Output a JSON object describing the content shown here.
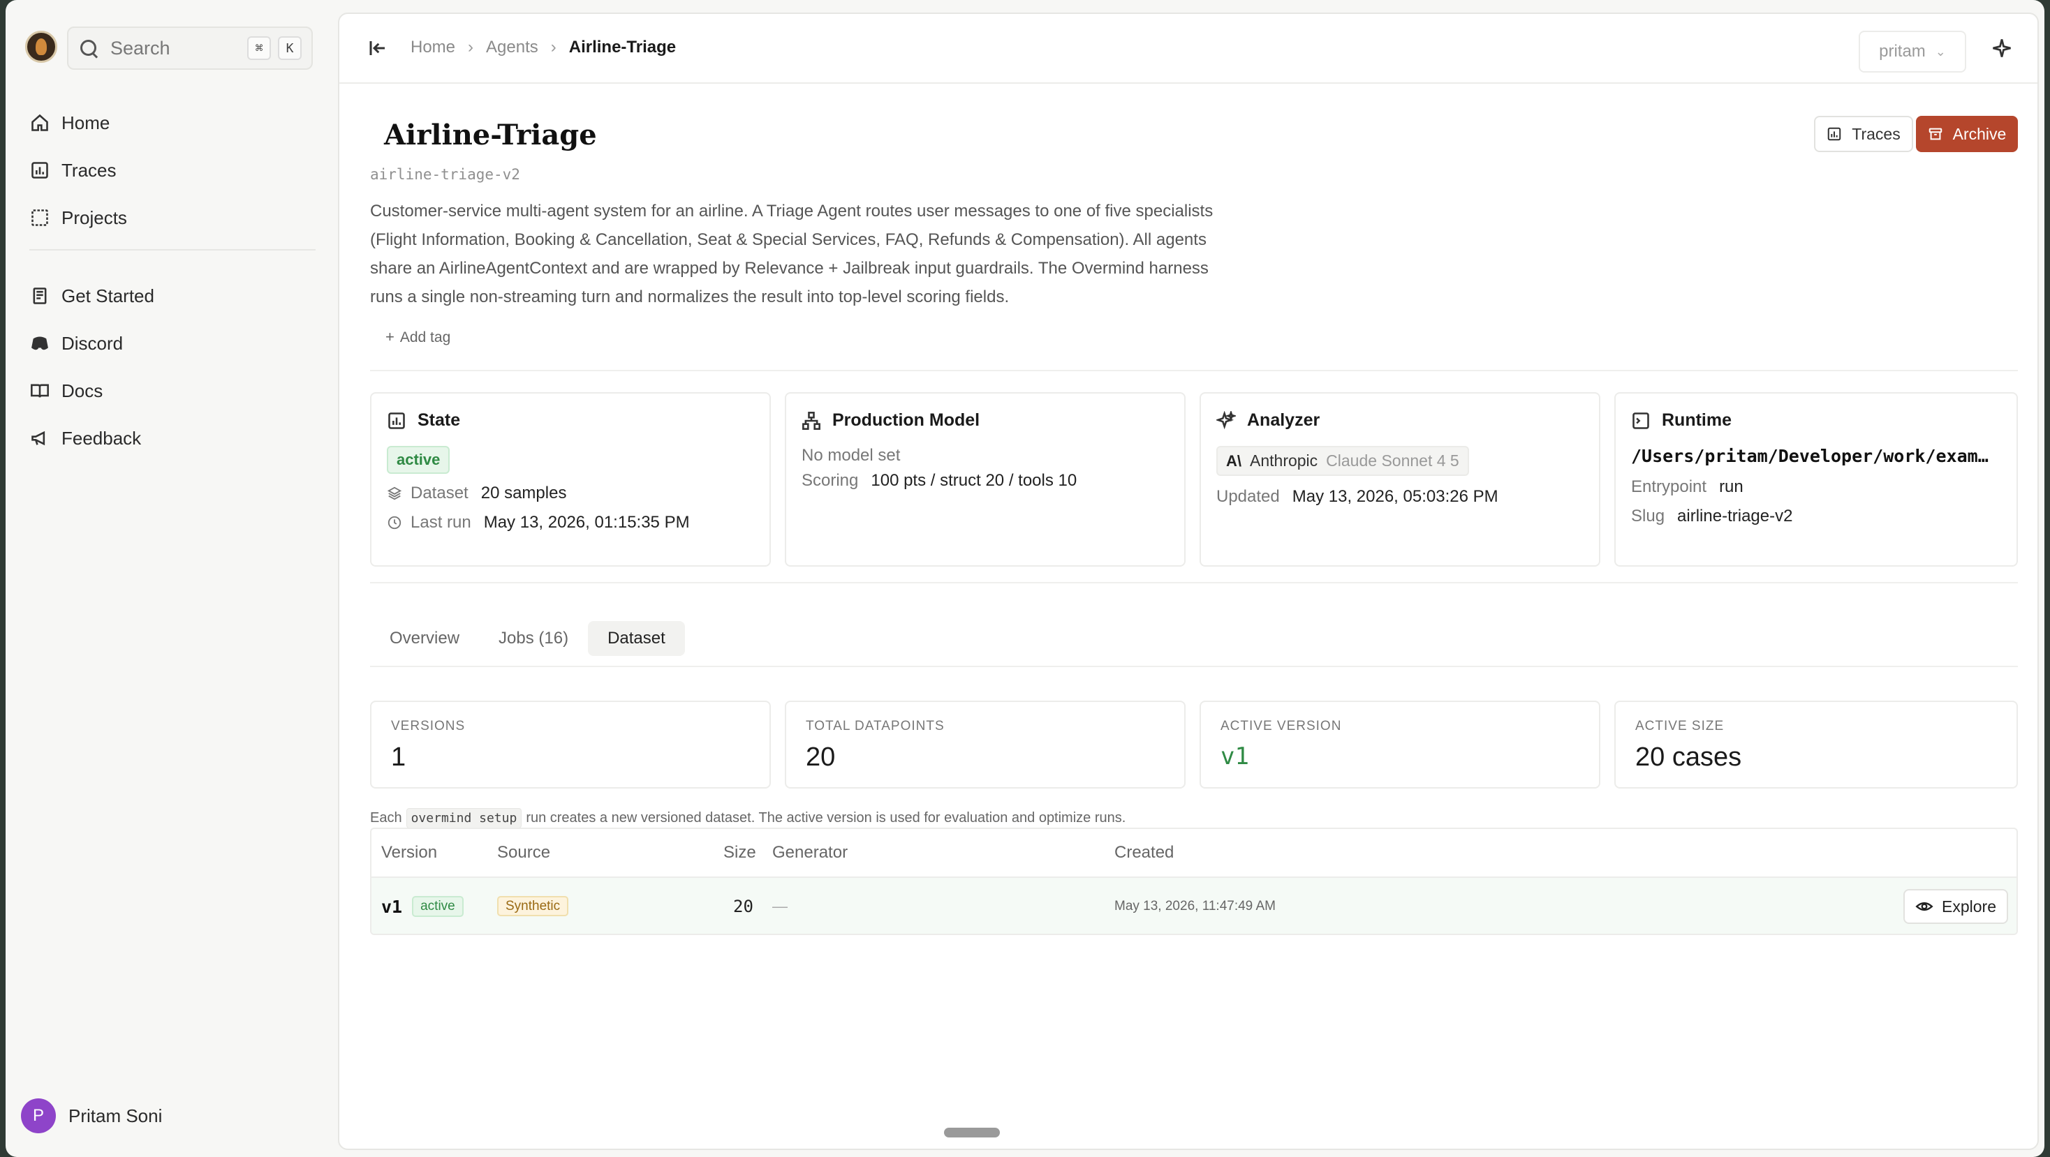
{
  "sidebar": {
    "search_placeholder": "Search",
    "shortcut_keys": [
      "⌘",
      "K"
    ],
    "items_primary": [
      {
        "label": "Home",
        "icon": "home-icon"
      },
      {
        "label": "Traces",
        "icon": "bar-chart-icon"
      },
      {
        "label": "Projects",
        "icon": "grid-icon"
      }
    ],
    "items_secondary": [
      {
        "label": "Get Started",
        "icon": "book-icon"
      },
      {
        "label": "Discord",
        "icon": "discord-icon"
      },
      {
        "label": "Docs",
        "icon": "docs-icon"
      },
      {
        "label": "Feedback",
        "icon": "megaphone-icon"
      }
    ],
    "user": {
      "initial": "P",
      "name": "Pritam Soni",
      "avatar_color": "#8e44c9"
    }
  },
  "topbar": {
    "breadcrumb": [
      "Home",
      "Agents",
      "Airline-Triage"
    ],
    "user_select": "pritam"
  },
  "agent": {
    "title": "Airline-Triage",
    "slug": "airline-triage-v2",
    "description": "Customer-service multi-agent system for an airline. A Triage Agent routes user messages to one of five specialists (Flight Information, Booking & Cancellation, Seat & Special Services, FAQ, Refunds & Compensation). All agents share an AirlineAgentContext and are wrapped by Relevance + Jailbreak input guardrails. The Overmind harness runs a single non-streaming turn and normalizes the result into top-level scoring fields.",
    "add_tag": "Add tag",
    "traces_button": "Traces",
    "archive_button": "Archive",
    "archive_color": "#b5462c"
  },
  "cards": {
    "state": {
      "title": "State",
      "status": "active",
      "dataset_label": "Dataset",
      "dataset_value": "20 samples",
      "last_run_label": "Last run",
      "last_run_value": "May 13, 2026, 01:15:35 PM"
    },
    "production_model": {
      "title": "Production Model",
      "no_model": "No model set",
      "scoring_label": "Scoring",
      "scoring_value": "100 pts / struct 20 / tools 10"
    },
    "analyzer": {
      "title": "Analyzer",
      "provider_icon": "A\\",
      "provider": "Anthropic",
      "model": "Claude Sonnet 4 5",
      "updated_label": "Updated",
      "updated_value": "May 13, 2026, 05:03:26 PM"
    },
    "runtime": {
      "title": "Runtime",
      "path": "/Users/pritam/Developer/work/examples/airline-triage",
      "entrypoint_label": "Entrypoint",
      "entrypoint_value": "run",
      "slug_label": "Slug",
      "slug_value": "airline-triage-v2"
    }
  },
  "tabs": [
    {
      "label": "Overview",
      "selected": false
    },
    {
      "label": "Jobs (16)",
      "selected": false
    },
    {
      "label": "Dataset",
      "selected": true
    }
  ],
  "stats": [
    {
      "label": "VERSIONS",
      "value": "1"
    },
    {
      "label": "TOTAL DATAPOINTS",
      "value": "20"
    },
    {
      "label": "ACTIVE VERSION",
      "value": "v1"
    },
    {
      "label": "ACTIVE SIZE",
      "value": "20 cases"
    }
  ],
  "note": {
    "prefix": "Each",
    "code": "overmind setup",
    "suffix": "run creates a new versioned dataset. The active version is used for evaluation and optimize runs."
  },
  "table": {
    "headers": [
      "Version",
      "Source",
      "Size",
      "Generator",
      "Created"
    ],
    "rows": [
      {
        "version": "v1",
        "status": "active",
        "source": "Synthetic",
        "size": "20",
        "generator": "—",
        "created": "May 13, 2026, 11:47:49 AM",
        "action": "Explore"
      }
    ]
  },
  "colors": {
    "active_green": "#2f8a44",
    "synthetic_amber": "#9a6a14"
  }
}
